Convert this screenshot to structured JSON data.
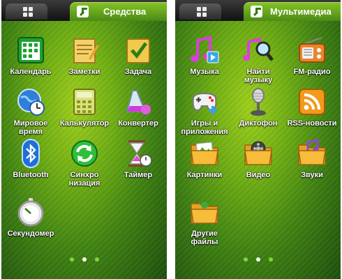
{
  "left": {
    "tab_title": "Средства",
    "apps": [
      {
        "label": "Календарь",
        "icon": "calendar-icon"
      },
      {
        "label": "Заметки",
        "icon": "notes-icon"
      },
      {
        "label": "Задача",
        "icon": "task-icon"
      },
      {
        "label": "Мировое\nвремя",
        "icon": "world-clock-icon"
      },
      {
        "label": "Калькулятор",
        "icon": "calculator-icon"
      },
      {
        "label": "Конвертер",
        "icon": "converter-icon"
      },
      {
        "label": "Bluetooth",
        "icon": "bluetooth-icon"
      },
      {
        "label": "Синхро\nнизация",
        "icon": "sync-icon"
      },
      {
        "label": "Таймер",
        "icon": "timer-icon"
      },
      {
        "label": "Секундомер",
        "icon": "stopwatch-icon"
      }
    ],
    "page_dots": 3,
    "active_page": 2
  },
  "right": {
    "tab_title": "Мультимедиа",
    "apps": [
      {
        "label": "Музыка",
        "icon": "music-icon"
      },
      {
        "label": "Найти\nмузыку",
        "icon": "find-music-icon"
      },
      {
        "label": "FM-радио",
        "icon": "radio-icon"
      },
      {
        "label": "Игры и\nприложения",
        "icon": "games-icon"
      },
      {
        "label": "Диктофон",
        "icon": "microphone-icon"
      },
      {
        "label": "RSS-новости",
        "icon": "rss-icon"
      },
      {
        "label": "Картинки",
        "icon": "pictures-folder-icon"
      },
      {
        "label": "Видео",
        "icon": "video-folder-icon"
      },
      {
        "label": "Звуки",
        "icon": "sounds-folder-icon"
      },
      {
        "label": "Другие\nфайлы",
        "icon": "other-files-folder-icon"
      }
    ],
    "page_dots": 3,
    "active_page": 2
  },
  "colors": {
    "accent": "#7fd63c",
    "tab_active": "#6aa81e",
    "background": "#4a8c14"
  }
}
